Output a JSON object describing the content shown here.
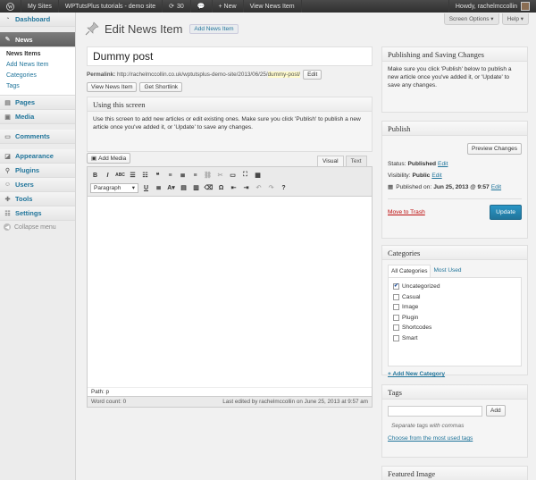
{
  "admin_bar": {
    "my_sites": "My Sites",
    "site_name": "WPTutsPlus tutorials - demo site",
    "updates_count": "30",
    "new_label": "+ New",
    "view_item": "View News Item",
    "howdy": "Howdy, rachelmccollin"
  },
  "sidebar": {
    "items": [
      {
        "label": "Dashboard",
        "icon": "dashboard-icon"
      },
      {
        "label": "News",
        "icon": "pushpin-icon"
      },
      {
        "label": "Pages",
        "icon": "pages-icon"
      },
      {
        "label": "Media",
        "icon": "media-icon"
      },
      {
        "label": "Comments",
        "icon": "comments-icon"
      },
      {
        "label": "Appearance",
        "icon": "appearance-icon"
      },
      {
        "label": "Plugins",
        "icon": "plugins-icon"
      },
      {
        "label": "Users",
        "icon": "users-icon"
      },
      {
        "label": "Tools",
        "icon": "tools-icon"
      },
      {
        "label": "Settings",
        "icon": "settings-icon"
      }
    ],
    "submenu": [
      "News Items",
      "Add News Item",
      "Categories",
      "Tags"
    ],
    "collapse": "Collapse menu"
  },
  "screen_options": "Screen Options ▾",
  "help": "Help ▾",
  "page": {
    "title": "Edit News Item",
    "add_new": "Add News Item",
    "post_title": "Dummy post",
    "permalink_label": "Permalink:",
    "permalink_base": "http://rachelmccollin.co.uk/wptutsplus-demo-site/2013/06/25/",
    "permalink_slug": "dummy-post/",
    "edit_btn": "Edit",
    "view_btn": "View News Item",
    "shortlink_btn": "Get Shortlink"
  },
  "using_screen": {
    "title": "Using this screen",
    "text": "Use this screen to add new articles or edit existing ones. Make sure you click 'Publish' to publish a new article once you've added it, or 'Update' to save any changes."
  },
  "editor": {
    "add_media": "Add Media",
    "tab_visual": "Visual",
    "tab_text": "Text",
    "format": "Paragraph",
    "path": "Path: p",
    "word_count": "Word count: 0",
    "last_edited": "Last edited by rachelmccollin on June 25, 2013 at 9:57 am"
  },
  "pubsave": {
    "title": "Publishing and Saving Changes",
    "text": "Make sure you click 'Publish' below to publish a new article once you've added it, or 'Update' to save any changes."
  },
  "publish": {
    "title": "Publish",
    "preview": "Preview Changes",
    "status_label": "Status:",
    "status_value": "Published",
    "visibility_label": "Visibility:",
    "visibility_value": "Public",
    "published_label": "Published on:",
    "published_value": "Jun 25, 2013 @ 9:57",
    "edit": "Edit",
    "trash": "Move to Trash",
    "update": "Update"
  },
  "categories": {
    "title": "Categories",
    "tab_all": "All Categories",
    "tab_most": "Most Used",
    "items": [
      {
        "label": "Uncategorized",
        "checked": true
      },
      {
        "label": "Casual",
        "checked": false
      },
      {
        "label": "Image",
        "checked": false
      },
      {
        "label": "Plugin",
        "checked": false
      },
      {
        "label": "Shortcodes",
        "checked": false
      },
      {
        "label": "Smart",
        "checked": false
      }
    ],
    "add_new": "+ Add New Category"
  },
  "tags": {
    "title": "Tags",
    "add": "Add",
    "hint": "Separate tags with commas",
    "choose": "Choose from the most used tags"
  },
  "featured": {
    "title": "Featured Image"
  }
}
